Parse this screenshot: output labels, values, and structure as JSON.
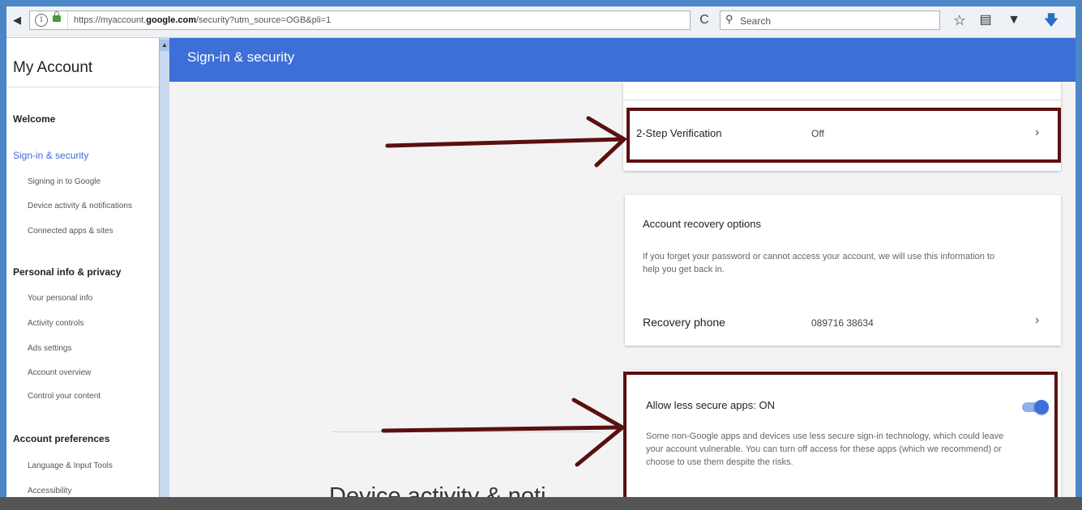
{
  "browser": {
    "url_prefix": "https://myaccount.",
    "url_host": "google.com",
    "url_path": "/security?utm_source=OGB&pli=1",
    "search_placeholder": "Search",
    "reload_glyph": "C",
    "icons": [
      "back-icon",
      "info-icon",
      "lock-icon",
      "reload-icon",
      "search-icon",
      "bookmark-star-icon",
      "reading-list-icon",
      "pocket-icon",
      "download-icon"
    ]
  },
  "sidebar": {
    "brand": "My Account",
    "sections": [
      {
        "label": "Welcome",
        "items": []
      },
      {
        "label": "Sign-in & security",
        "active": true,
        "items": [
          "Signing in to Google",
          "Device activity & notifications",
          "Connected apps & sites"
        ]
      },
      {
        "label": "Personal info & privacy",
        "items": [
          "Your personal info",
          "Activity controls",
          "Ads settings",
          "Account overview",
          "Control your content"
        ]
      },
      {
        "label": "Account preferences",
        "items": [
          "Language & Input Tools",
          "Accessibility"
        ]
      }
    ]
  },
  "header": {
    "title": "Sign-in & security"
  },
  "main": {
    "two_step": {
      "label": "2-Step Verification",
      "value": "Off"
    },
    "recovery": {
      "title": "Account recovery options",
      "description": "If you forget your password or cannot access your account, we will use this information to help you get back in.",
      "phone_label": "Recovery phone",
      "phone_value": "089716 38634"
    },
    "less_secure": {
      "title": "Allow less secure apps: ON",
      "enabled": true,
      "description": "Some non-Google apps and devices use less secure sign-in technology, which could leave your account vulnerable. You can turn off access for these apps (which we recommend) or choose to use them despite the risks."
    },
    "next_section_heading": "Device activity & noti"
  },
  "colors": {
    "header_bg": "#3d6fd8",
    "outer_border": "#4a86c8",
    "annotation": "#5a1010",
    "toggle_on": "#3d6fd8"
  }
}
